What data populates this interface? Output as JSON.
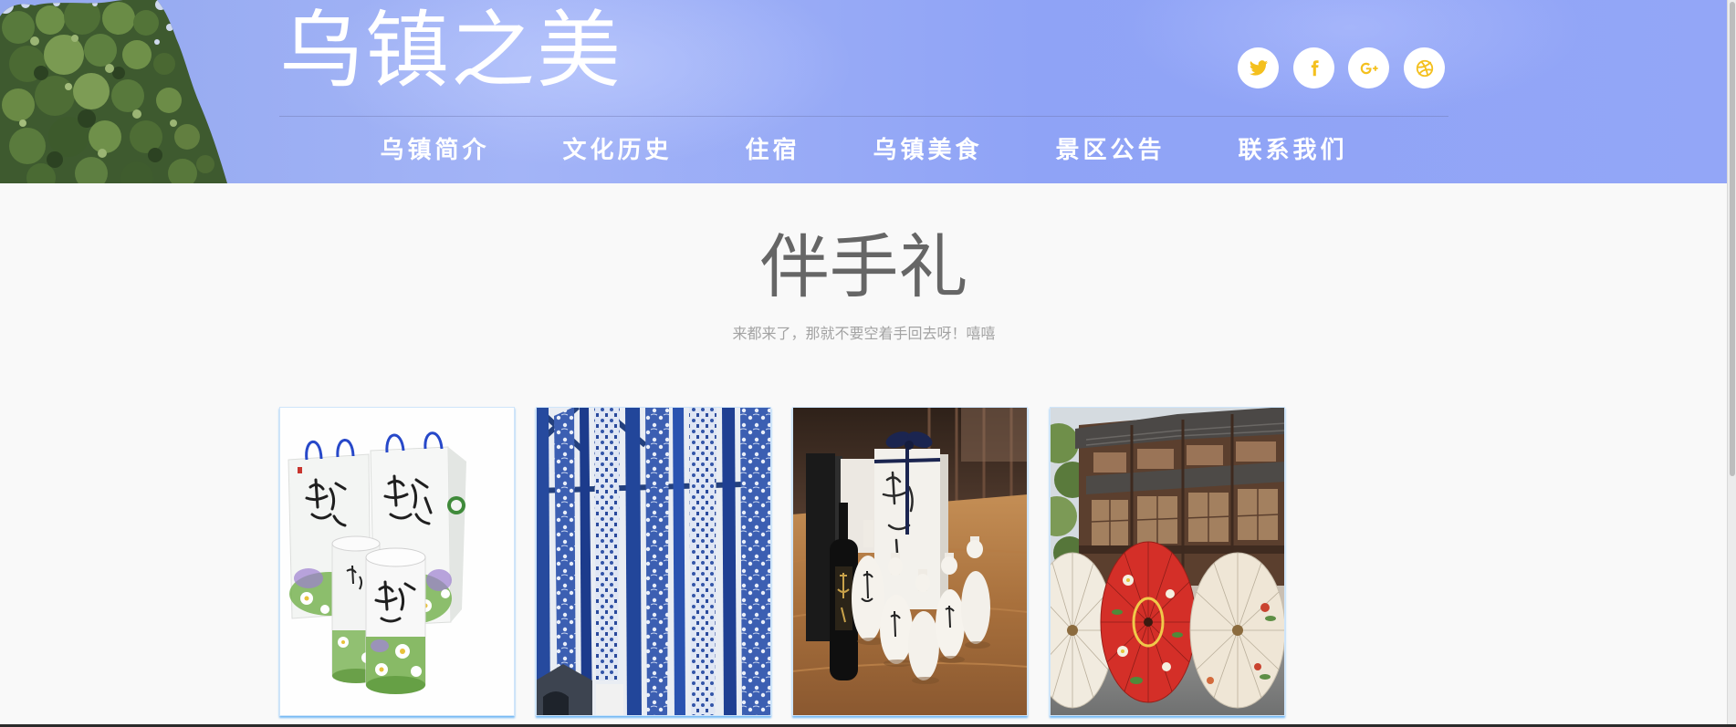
{
  "header": {
    "title": "乌镇之美",
    "social": [
      {
        "icon": "twitter-icon"
      },
      {
        "icon": "facebook-icon"
      },
      {
        "icon": "google-plus-icon"
      },
      {
        "icon": "dribbble-icon"
      }
    ]
  },
  "nav": {
    "items": [
      {
        "label": "乌镇简介"
      },
      {
        "label": "文化历史"
      },
      {
        "label": "住宿"
      },
      {
        "label": "乌镇美食"
      },
      {
        "label": "景区公告"
      },
      {
        "label": "联系我们"
      }
    ]
  },
  "section": {
    "title": "伴手礼",
    "subtitle": "来都来了，那就不要空着手回去呀！嘻嘻"
  },
  "theme": {
    "header_blue": "#8fa3f6",
    "icon_yellow": "#f4c01e",
    "title_gray": "#666666",
    "subtitle_gray": "#a3a3a3",
    "card_accent": "#6fb6f4",
    "page_bg": "#f9f9f9"
  }
}
